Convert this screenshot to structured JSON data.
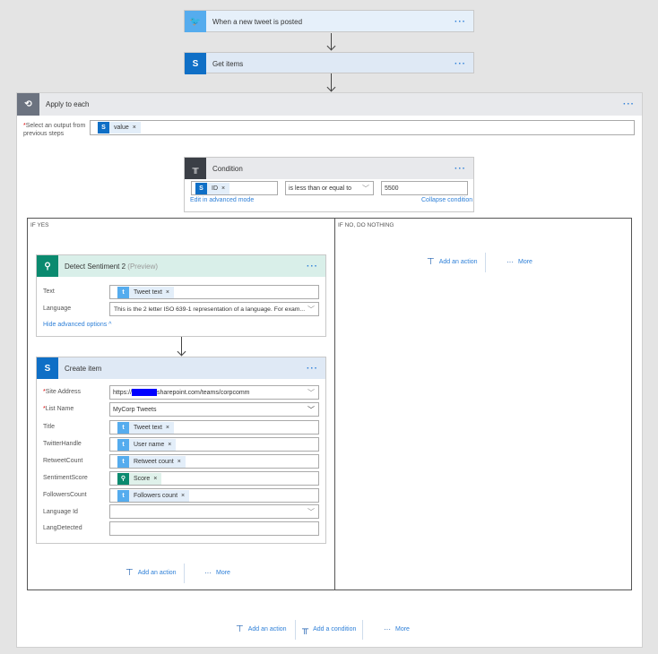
{
  "trigger": {
    "title": "When a new tweet is posted",
    "menu": "···"
  },
  "get_items": {
    "title": "Get items",
    "menu": "···"
  },
  "apply_each": {
    "title": "Apply to each",
    "menu": "···",
    "select_label": "Select an output from previous steps",
    "token": "value"
  },
  "condition": {
    "title": "Condition",
    "menu": "···",
    "left_token": "ID",
    "operator": "is less than or equal to",
    "value": "5500",
    "edit_link": "Edit in advanced mode",
    "collapse_link": "Collapse condition"
  },
  "if_yes": {
    "label": "IF YES"
  },
  "if_no": {
    "label": "IF NO, DO NOTHING",
    "add_action": "Add an action",
    "more": "More"
  },
  "detect": {
    "title": "Detect Sentiment 2",
    "preview": "(Preview)",
    "menu": "···",
    "text_label": "Text",
    "text_token": "Tweet text",
    "language_label": "Language",
    "language_placeholder": "This is the 2 letter ISO 639-1 representation of a language. For exam...",
    "hide_link": "Hide advanced options"
  },
  "create": {
    "title": "Create item",
    "menu": "···",
    "site_label": "Site Address",
    "site_prefix": "https://",
    "site_suffix": "sharepoint.com/teams/corpcomm",
    "list_label": "List Name",
    "list_value": "MyCorp Tweets",
    "fields": [
      {
        "label": "Title",
        "token": "Tweet text",
        "src": "twitter"
      },
      {
        "label": "TwitterHandle",
        "token": "User name",
        "src": "twitter"
      },
      {
        "label": "RetweetCount",
        "token": "Retweet count",
        "src": "twitter"
      },
      {
        "label": "SentimentScore",
        "token": "Score",
        "src": "text-analytics"
      },
      {
        "label": "FollowersCount",
        "token": "Followers count",
        "src": "twitter"
      }
    ],
    "language_id_label": "Language Id",
    "lang_detected_label": "LangDetected"
  },
  "yes_actions": {
    "add_action": "Add an action",
    "more": "More"
  },
  "bottom_actions": {
    "add_action": "Add an action",
    "add_condition": "Add a condition",
    "more": "More"
  }
}
